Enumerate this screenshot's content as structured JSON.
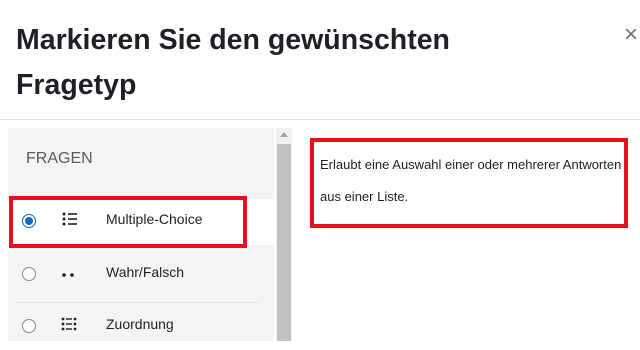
{
  "dialog": {
    "title": "Markieren Sie den gewünschten Fragetyp",
    "close_symbol": "×"
  },
  "sidebar": {
    "heading": "FRAGEN",
    "options": [
      {
        "label": "Multiple-Choice",
        "icon": "multichoice-list-icon",
        "selected": true
      },
      {
        "label": "Wahr/Falsch",
        "icon": "two-dots-icon",
        "selected": false
      },
      {
        "label": "Zuordnung",
        "icon": "matching-icon",
        "selected": false
      }
    ]
  },
  "description": {
    "text": "Erlaubt eine Auswahl einer oder mehrerer Antworten aus einer Liste."
  },
  "colors": {
    "accent": "#0f6cbf",
    "highlight": "#e8101a",
    "sidebar_bg": "#f4f4f4"
  }
}
